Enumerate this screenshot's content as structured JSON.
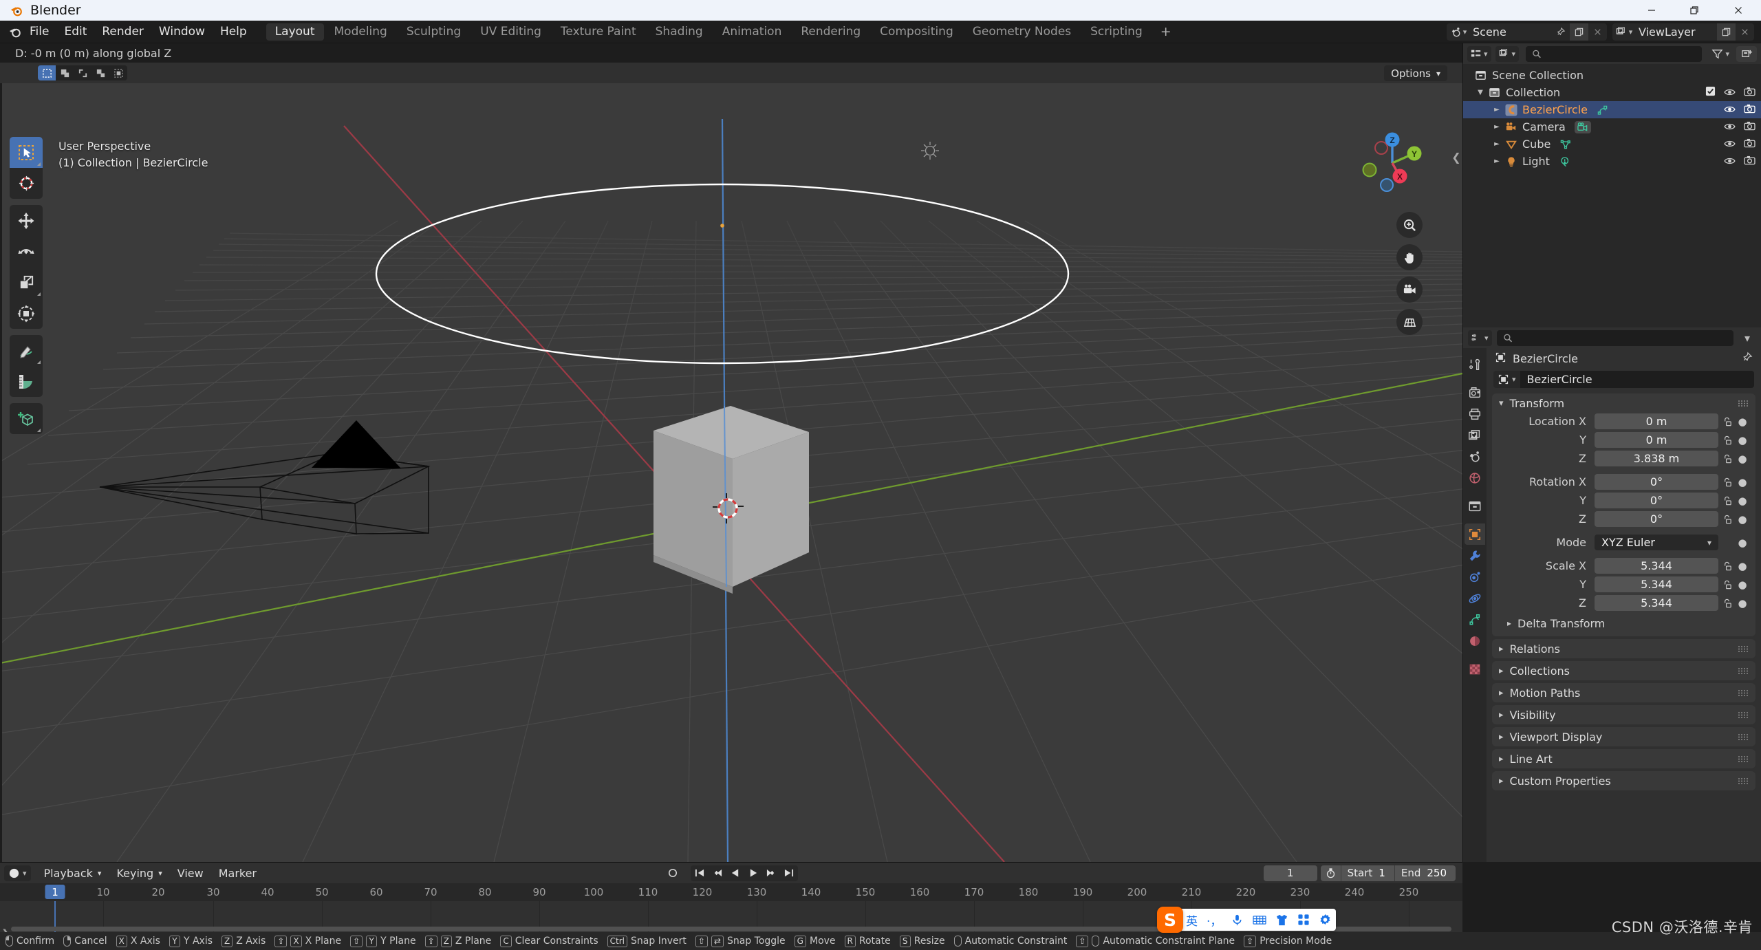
{
  "window": {
    "title": "Blender",
    "controls": {
      "minimize": "—",
      "maximize": "❐",
      "close": "✕"
    }
  },
  "topbar": {
    "menus": [
      "File",
      "Edit",
      "Render",
      "Window",
      "Help"
    ],
    "workspaces": [
      {
        "label": "Layout",
        "active": true
      },
      {
        "label": "Modeling",
        "active": false
      },
      {
        "label": "Sculpting",
        "active": false
      },
      {
        "label": "UV Editing",
        "active": false
      },
      {
        "label": "Texture Paint",
        "active": false
      },
      {
        "label": "Shading",
        "active": false
      },
      {
        "label": "Animation",
        "active": false
      },
      {
        "label": "Rendering",
        "active": false
      },
      {
        "label": "Compositing",
        "active": false
      },
      {
        "label": "Geometry Nodes",
        "active": false
      },
      {
        "label": "Scripting",
        "active": false
      }
    ],
    "add_workspace": "+",
    "scene": {
      "name": "Scene",
      "icon": "scene-icon"
    },
    "viewlayer": {
      "name": "ViewLayer",
      "icon": "viewlayer-icon"
    }
  },
  "viewport": {
    "header_status": "D: -0 m (0 m) along global Z",
    "options_label": "Options",
    "overlay_line1": "User Perspective",
    "overlay_line2": "(1) Collection | BezierCircle",
    "gizmo": {
      "x": "X",
      "y": "Y",
      "z": "Z"
    },
    "select_modes": [
      "set-new-selection",
      "extend-selection",
      "subtract-selection",
      "invert-selection",
      "intersect-selection"
    ],
    "tools": [
      {
        "name": "tweak-select-tool",
        "active": true
      },
      {
        "name": "cursor-tool",
        "active": false
      },
      {
        "name": "move-tool",
        "active": false
      },
      {
        "name": "rotate-tool",
        "active": false
      },
      {
        "name": "scale-tool",
        "active": false
      },
      {
        "name": "transform-tool",
        "active": false
      },
      {
        "name": "annotate-tool",
        "active": false
      },
      {
        "name": "measure-tool",
        "active": false
      },
      {
        "name": "add-cube-tool",
        "active": false
      }
    ],
    "nav_buttons": [
      "zoom-icon",
      "pan-hand-icon",
      "camera-view-icon",
      "ortho-persp-icon"
    ],
    "colors": {
      "background": "#3b3b3b",
      "grid": "#4c4c4c",
      "axis_x": "#a8414b",
      "axis_y": "#7aa830",
      "axis_z": "#4772b3",
      "curve_selected": "#ffffff",
      "cube_fill": "#a6a6a6"
    }
  },
  "outliner": {
    "search_placeholder": "",
    "root": "Scene Collection",
    "items": [
      {
        "label": "Collection",
        "level": 1,
        "icon": "collection-icon",
        "selected": false,
        "checkbox": true,
        "disclosure": "open",
        "data_icon": null
      },
      {
        "label": "BezierCircle",
        "level": 2,
        "icon": "curve-object-icon",
        "selected": true,
        "checkbox": false,
        "disclosure": "closed",
        "data_icon": "curve-data-icon"
      },
      {
        "label": "Camera",
        "level": 2,
        "icon": "camera-object-icon",
        "selected": false,
        "checkbox": false,
        "disclosure": "closed",
        "data_icon": "camera-data-icon"
      },
      {
        "label": "Cube",
        "level": 2,
        "icon": "mesh-object-icon",
        "selected": false,
        "checkbox": false,
        "disclosure": "closed",
        "data_icon": "mesh-data-icon"
      },
      {
        "label": "Light",
        "level": 2,
        "icon": "light-object-icon",
        "selected": false,
        "checkbox": false,
        "disclosure": "closed",
        "data_icon": "light-data-icon"
      }
    ]
  },
  "properties": {
    "search_placeholder": "",
    "breadcrumb": "BezierCircle",
    "id_name": "BezierCircle",
    "tabs": [
      {
        "name": "tool-tab",
        "active": false
      },
      {
        "name": "render-tab",
        "active": false
      },
      {
        "name": "output-tab",
        "active": false
      },
      {
        "name": "view-layer-tab",
        "active": false
      },
      {
        "name": "scene-tab",
        "active": false
      },
      {
        "name": "world-tab",
        "active": false
      },
      {
        "name": "collection-tab",
        "active": false
      },
      {
        "name": "object-tab",
        "active": true
      },
      {
        "name": "modifier-tab",
        "active": false
      },
      {
        "name": "particles-tab",
        "active": false
      },
      {
        "name": "physics-tab",
        "active": false
      },
      {
        "name": "object-data-tab",
        "active": false
      },
      {
        "name": "material-tab",
        "active": false
      },
      {
        "name": "texture-tab",
        "active": false
      }
    ],
    "transform": {
      "title": "Transform",
      "location": {
        "label": "Location X",
        "x": "0 m",
        "y": "0 m",
        "z": "3.838 m"
      },
      "rotation": {
        "label": "Rotation X",
        "x": "0°",
        "y": "0°",
        "z": "0°"
      },
      "mode": {
        "label": "Mode",
        "value": "XYZ Euler"
      },
      "scale": {
        "label": "Scale X",
        "x": "5.344",
        "y": "5.344",
        "z": "5.344"
      },
      "axis_y": "Y",
      "axis_z": "Z"
    },
    "subpanel_delta": "Delta Transform",
    "panels": [
      "Relations",
      "Collections",
      "Motion Paths",
      "Visibility",
      "Viewport Display",
      "Line Art",
      "Custom Properties"
    ]
  },
  "timeline": {
    "menus": [
      "Playback",
      "Keying",
      "View",
      "Marker"
    ],
    "playback_chev": "⌄",
    "current_frame": "1",
    "start_label": "Start",
    "start_value": "1",
    "end_label": "End",
    "end_value": "250",
    "ticks": [
      "10",
      "20",
      "30",
      "40",
      "50",
      "60",
      "70",
      "80",
      "90",
      "100",
      "110",
      "120",
      "130",
      "140",
      "150",
      "160",
      "170",
      "180",
      "190",
      "200",
      "210",
      "220",
      "230",
      "240",
      "250"
    ],
    "playhead_frame": "1",
    "transport": [
      "jump-to-start",
      "jump-to-prev-keyframe",
      "play-reverse",
      "play",
      "jump-to-next-keyframe",
      "jump-to-end"
    ]
  },
  "statusbar": {
    "items": [
      {
        "keys": [
          "lmb"
        ],
        "label": "Confirm"
      },
      {
        "keys": [
          "rmb"
        ],
        "label": "Cancel"
      },
      {
        "keys": [
          "X"
        ],
        "label": "X Axis"
      },
      {
        "keys": [
          "Y"
        ],
        "label": "Y Axis"
      },
      {
        "keys": [
          "Z"
        ],
        "label": "Z Axis"
      },
      {
        "keys": [
          "⇧",
          "X"
        ],
        "label": "X Plane"
      },
      {
        "keys": [
          "⇧",
          "Y"
        ],
        "label": "Y Plane"
      },
      {
        "keys": [
          "⇧",
          "Z"
        ],
        "label": "Z Plane"
      },
      {
        "keys": [
          "C"
        ],
        "label": "Clear Constraints"
      },
      {
        "keys": [
          "Ctrl"
        ],
        "label": "Snap Invert"
      },
      {
        "keys": [
          "⇧",
          "⇄"
        ],
        "label": "Snap Toggle"
      },
      {
        "keys": [
          "G"
        ],
        "label": "Move"
      },
      {
        "keys": [
          "R"
        ],
        "label": "Rotate"
      },
      {
        "keys": [
          "S"
        ],
        "label": "Resize"
      },
      {
        "keys": [
          "mmb"
        ],
        "label": "Automatic Constraint"
      },
      {
        "keys": [
          "⇧",
          "mmb"
        ],
        "label": "Automatic Constraint Plane"
      },
      {
        "keys": [
          "⇧"
        ],
        "label": "Precision Mode"
      }
    ]
  },
  "ime": {
    "logo": "S",
    "items": [
      "英",
      "·，",
      "mic-icon",
      "keyboard-icon",
      "skin-icon",
      "apps-icon",
      "settings-icon"
    ]
  },
  "watermark": "CSDN @沃洛德.辛肯"
}
